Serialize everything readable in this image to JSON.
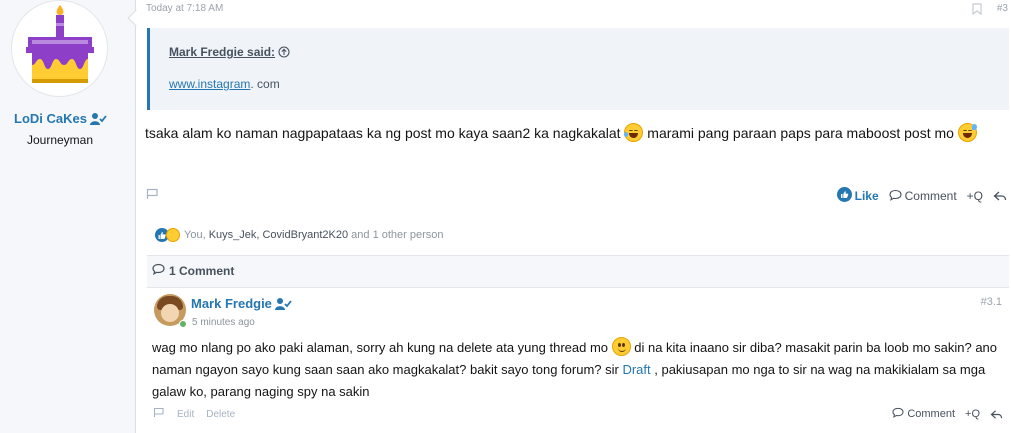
{
  "user": {
    "name": "LoDi CaKes",
    "title": "Journeyman"
  },
  "post": {
    "timestamp": "Today at 7:18 AM",
    "number": "#3",
    "quote": {
      "author": "Mark Fredgie said:",
      "link_text": "www.instagram",
      "text_after": ". com"
    },
    "body_part1": "tsaka alam ko naman nagpapataas ka ng post mo kaya saan2 ka nagkakalat",
    "body_part2": " marami pang paraan paps para maboost post mo",
    "actions": {
      "like": "Like",
      "comment": "Comment",
      "quote": "+Q"
    },
    "reactions": {
      "you": "You, ",
      "names": "Kuys_Jek, CovidBryant2K20",
      "rest": " and 1 other person"
    }
  },
  "comments": {
    "header": "1 Comment",
    "items": [
      {
        "author": "Mark Fredgie",
        "time": "5 minutes ago",
        "number": "#3.1",
        "text_part1": "wag mo nlang po ako paki alaman, sorry ah kung na delete ata yung thread mo ",
        "text_part2": " di na kita inaano sir diba? masakit parin ba loob mo sakin? ano naman ngayon sayo kung saan saan ako magkakalat? bakit sayo tong forum? sir ",
        "link": "Draft",
        "text_part3": " , pakiusapan mo nga to sir na wag na makikialam sa mga galaw ko, parang naging spy na sakin",
        "edit": "Edit",
        "delete": "Delete",
        "comment": "Comment",
        "quote": "+Q"
      }
    ]
  },
  "icons": [
    "birthday-cake-avatar",
    "user-verified-icon",
    "bookmark-icon",
    "arrow-up-circle-icon",
    "flag-icon",
    "thumbs-up-icon",
    "speech-bubble-icon",
    "reply-icon",
    "laughing-emoji",
    "smile-emoji"
  ],
  "colors": {
    "accent": "#2577b1",
    "muted": "#8c959e",
    "quote_bg": "#f0f4f8"
  }
}
